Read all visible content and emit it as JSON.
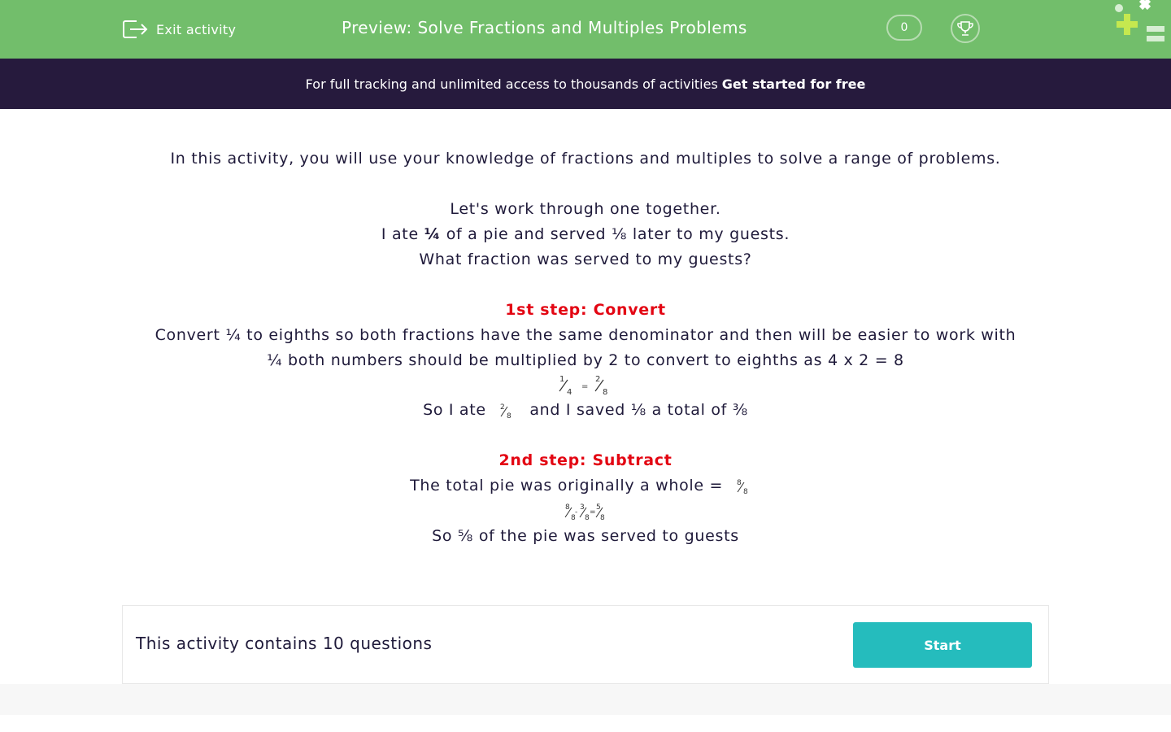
{
  "header": {
    "exit_label": "Exit activity",
    "title": "Preview: Solve Fractions and Multiples Problems",
    "score": "0",
    "icons": [
      "exit-icon",
      "trophy-icon",
      "logo-icon"
    ],
    "colors": {
      "bar": "#72be6b",
      "promo": "#261a3d",
      "accent_red": "#e30613",
      "button": "#25bcbd"
    }
  },
  "promo": {
    "text": "For full tracking and unlimited access to thousands of activities",
    "cta": "Get started for free"
  },
  "content": {
    "intro": "In this activity, you will use your knowledge of fractions and multiples to solve a range of problems.",
    "example_1": "Let's work through one together.",
    "example_2_pre": "I ate",
    "example_2_frac": "¼",
    "example_2_post": "of a pie and served ⅛ later to my guests.",
    "example_3": "What fraction was served to my guests?",
    "step1_title": "1st step: Convert",
    "step1_line1": "Convert ¼ to eighths so both fractions have the same denominator and then will be easier to work with",
    "step1_line2": "¼ both numbers should be multiplied by 2 to convert to eighths as 4 x 2 = 8",
    "so_ate_pre": "So I ate",
    "so_ate_post": "and I saved ⅛ a total of ⅜",
    "step2_title": "2nd step: Subtract",
    "total_line": "The total pie was originally a whole =",
    "conclusion_pre": "So ⅝",
    "conclusion_post": "of the pie was served to guests"
  },
  "footer": {
    "count_text": "This activity contains 10 questions",
    "start_label": "Start"
  }
}
